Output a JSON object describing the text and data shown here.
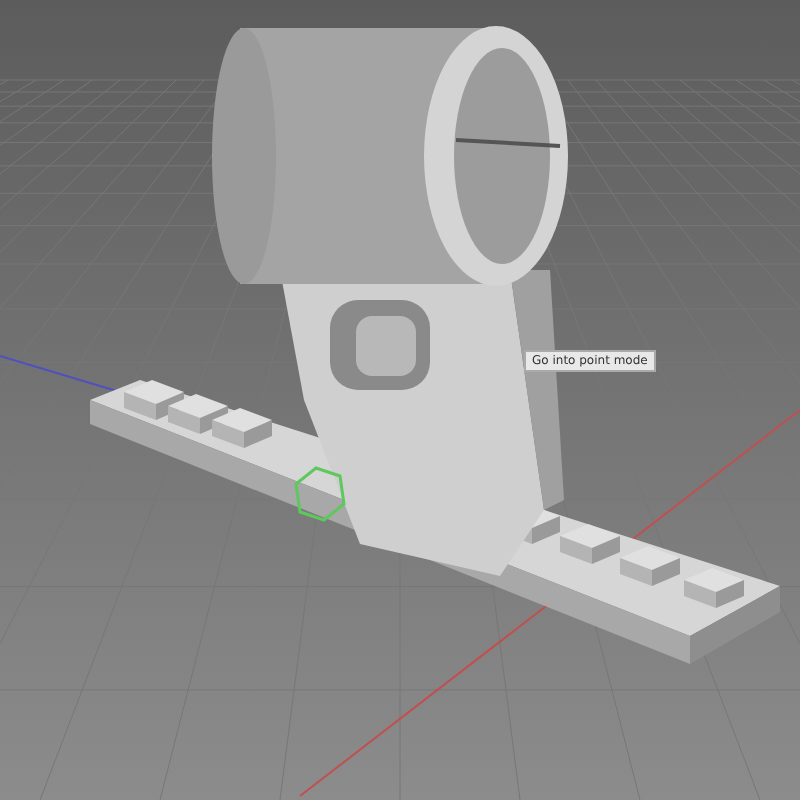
{
  "viewport": {
    "tooltip": "Go into point mode"
  }
}
